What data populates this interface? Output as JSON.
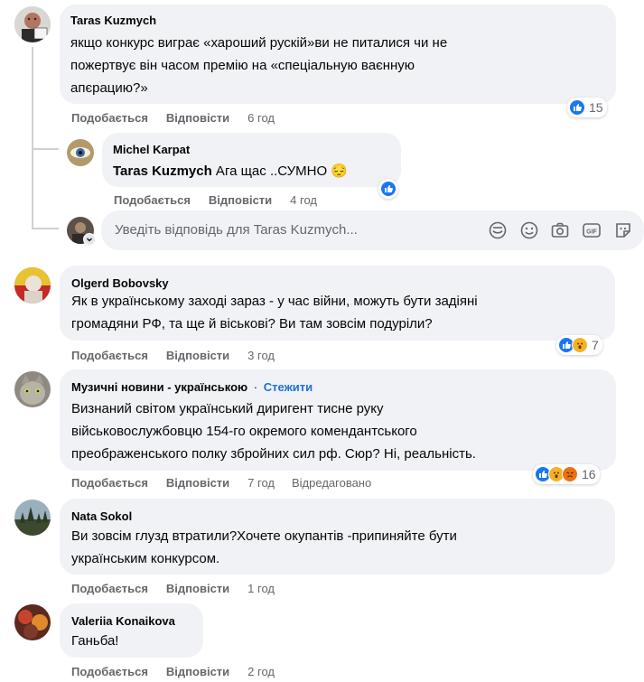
{
  "comments": [
    {
      "author": "Taras Kuzmych",
      "lines": [
        "якщо конкурс виграє «хароший рускій»ви не питалися чи не",
        "пожертвує він часом премію на «спеціальную ваєнную",
        "апєрацию?»"
      ],
      "like_label": "Подобається",
      "reply_label": "Відповісти",
      "time": "6 год",
      "reaction_count": "15"
    },
    {
      "author": "Olgerd Bobovsky",
      "lines": [
        "Як в українському заході зараз - у час війни, можуть бути задіяні",
        "громадяни РФ, та ще й віськові? Ви там зовсім подуріли?"
      ],
      "like_label": "Подобається",
      "reply_label": "Відповісти",
      "time": "3 год",
      "reaction_count": "7"
    },
    {
      "author": "Музичні новини - українською",
      "follow_sep": "·",
      "follow_label": "Стежити",
      "lines": [
        "Визнаний світом український диригент тисне руку",
        "військовослужбовцю 154-го окремого комендантського",
        "преображенського полку збройних сил рф. Сюр? Ні, реальність."
      ],
      "like_label": "Подобається",
      "reply_label": "Відповісти",
      "time": "7 год",
      "edited": "Відредаговано",
      "reaction_count": "16"
    },
    {
      "author": "Nata Sokol",
      "lines": [
        "Ви зовсім глузд втратили?Хочете окупантів -припиняйте бути",
        "українським конкурсом."
      ],
      "like_label": "Подобається",
      "reply_label": "Відповісти",
      "time": "1 год"
    },
    {
      "author": "Valeriia Konaikova",
      "lines": [
        "Ганьба!"
      ],
      "like_label": "Подобається",
      "reply_label": "Відповісти",
      "time": "2 год"
    }
  ],
  "reply": {
    "author": "Michel Karpat",
    "mention": "Taras Kuzmych",
    "text": " Ага щас ..СУМНО ",
    "emoji": "😔",
    "like_label": "Подобається",
    "reply_label": "Відповісти",
    "time": "4 год"
  },
  "reply_input": {
    "placeholder": "Уведіть відповідь для Taras Kuzmych..."
  },
  "icons": {
    "composer": [
      "sticker-face-icon",
      "emoji-icon",
      "camera-icon",
      "gif-icon",
      "sticker-icon"
    ]
  },
  "colors": {
    "like_blue": "#1877f2",
    "link_blue": "#216fdb",
    "bubble": "#f0f2f5",
    "secondary_text": "#65676b"
  }
}
